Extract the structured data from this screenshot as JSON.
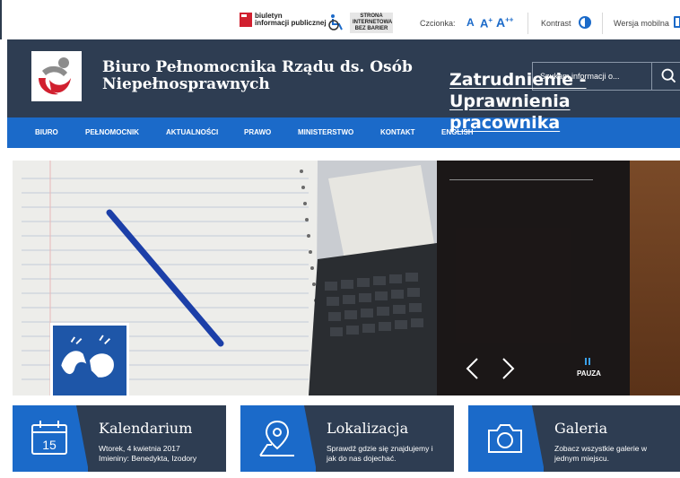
{
  "topbar": {
    "bip_line1": "biuletyn",
    "bip_line2": "informacji publicznej",
    "sibb_line1": "STRONA",
    "sibb_line2": "INTERNETOWA",
    "sibb_line3": "BEZ BARIER",
    "font_label": "Czcionka:",
    "font_a1": "A",
    "font_a2": "A",
    "font_a2_sup": "+",
    "font_a3": "A",
    "font_a3_sup": "++",
    "contrast_label": "Kontrast",
    "mobile_label": "Wersja mobilna"
  },
  "header": {
    "title": "Biuro Pełnomocnika Rządu ds. Osób Niepełnosprawnych",
    "search_placeholder": "Szukam informacji o..."
  },
  "nav": {
    "items": [
      {
        "label": "BIURO"
      },
      {
        "label": "PEŁNOMOCNIK"
      },
      {
        "label": "AKTUALNOŚCI"
      },
      {
        "label": "PRAWO"
      },
      {
        "label": "MINISTERSTWO"
      },
      {
        "label": "KONTAKT"
      },
      {
        "label": "ENGLISH"
      }
    ]
  },
  "hero": {
    "title": "Zatrudnienie - Uprawnienia pracownika",
    "pause_label": "PAUZA"
  },
  "tiles": [
    {
      "title": "Kalendarium",
      "line1": "Wtorek, 4 kwietnia 2017",
      "line2": "Imieniny: Benedykta, Izodory",
      "icon": "calendar-icon",
      "day": "15"
    },
    {
      "title": "Lokalizacja",
      "line1": "Sprawdź gdzie się znajdujemy i",
      "line2": "jak do nas dojechać.",
      "icon": "map-pin-icon"
    },
    {
      "title": "Galeria",
      "line1": "Zobacz wszystkie galerie w",
      "line2": "jednym miejscu.",
      "icon": "camera-icon"
    }
  ],
  "colors": {
    "header_bg": "#2e3d52",
    "nav_bg": "#1b6ac9",
    "accent_blue": "#1b6ac9",
    "bip_red": "#d1202f"
  }
}
